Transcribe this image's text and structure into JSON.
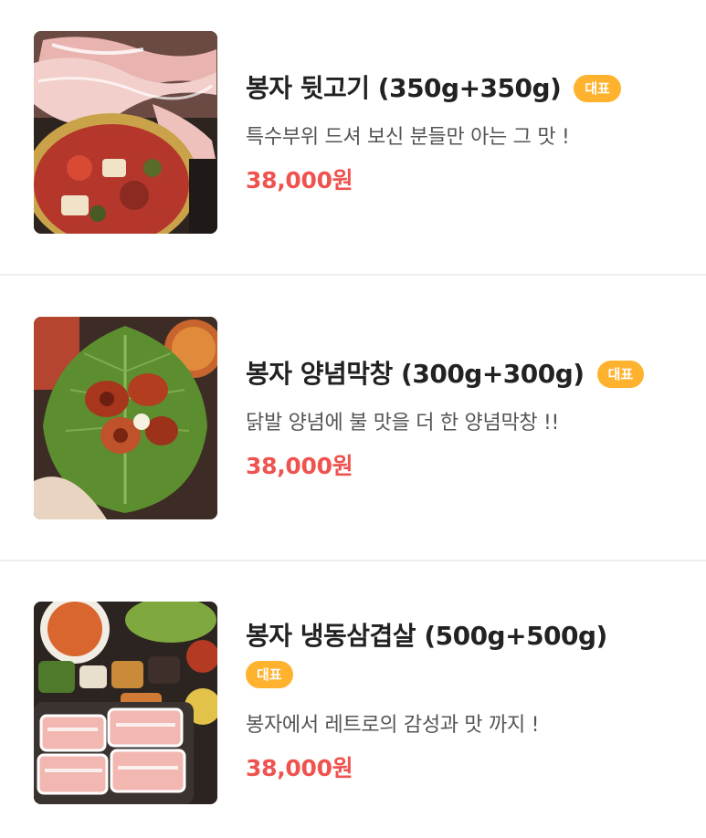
{
  "menu": {
    "items": [
      {
        "title": "봉자 뒷고기 (350g+350g)",
        "badge": "대표",
        "description": "특수부위 드셔 보신 분들만 아는 그 맛 !",
        "price": "38,000원"
      },
      {
        "title": "봉자 양념막창 (300g+300g)",
        "badge": "대표",
        "description": "닭발 양념에 불 맛을 더 한 양념막창 !!",
        "price": "38,000원"
      },
      {
        "title": "봉자 냉동삼겹살 (500g+500g)",
        "badge": "대표",
        "description": "봉자에서 레트로의 감성과 맛 까지 !",
        "price": "38,000원"
      }
    ]
  },
  "colors": {
    "badge": "#ffb22e",
    "price": "#ef5350",
    "title": "#222222",
    "description": "#555555",
    "divider": "#eeeeee"
  },
  "icons": {
    "item_1_image": "grilled-pork-and-stew-photo",
    "item_2_image": "marinated-intestine-in-perilla-leaf-photo",
    "item_3_image": "frozen-pork-belly-set-photo"
  }
}
